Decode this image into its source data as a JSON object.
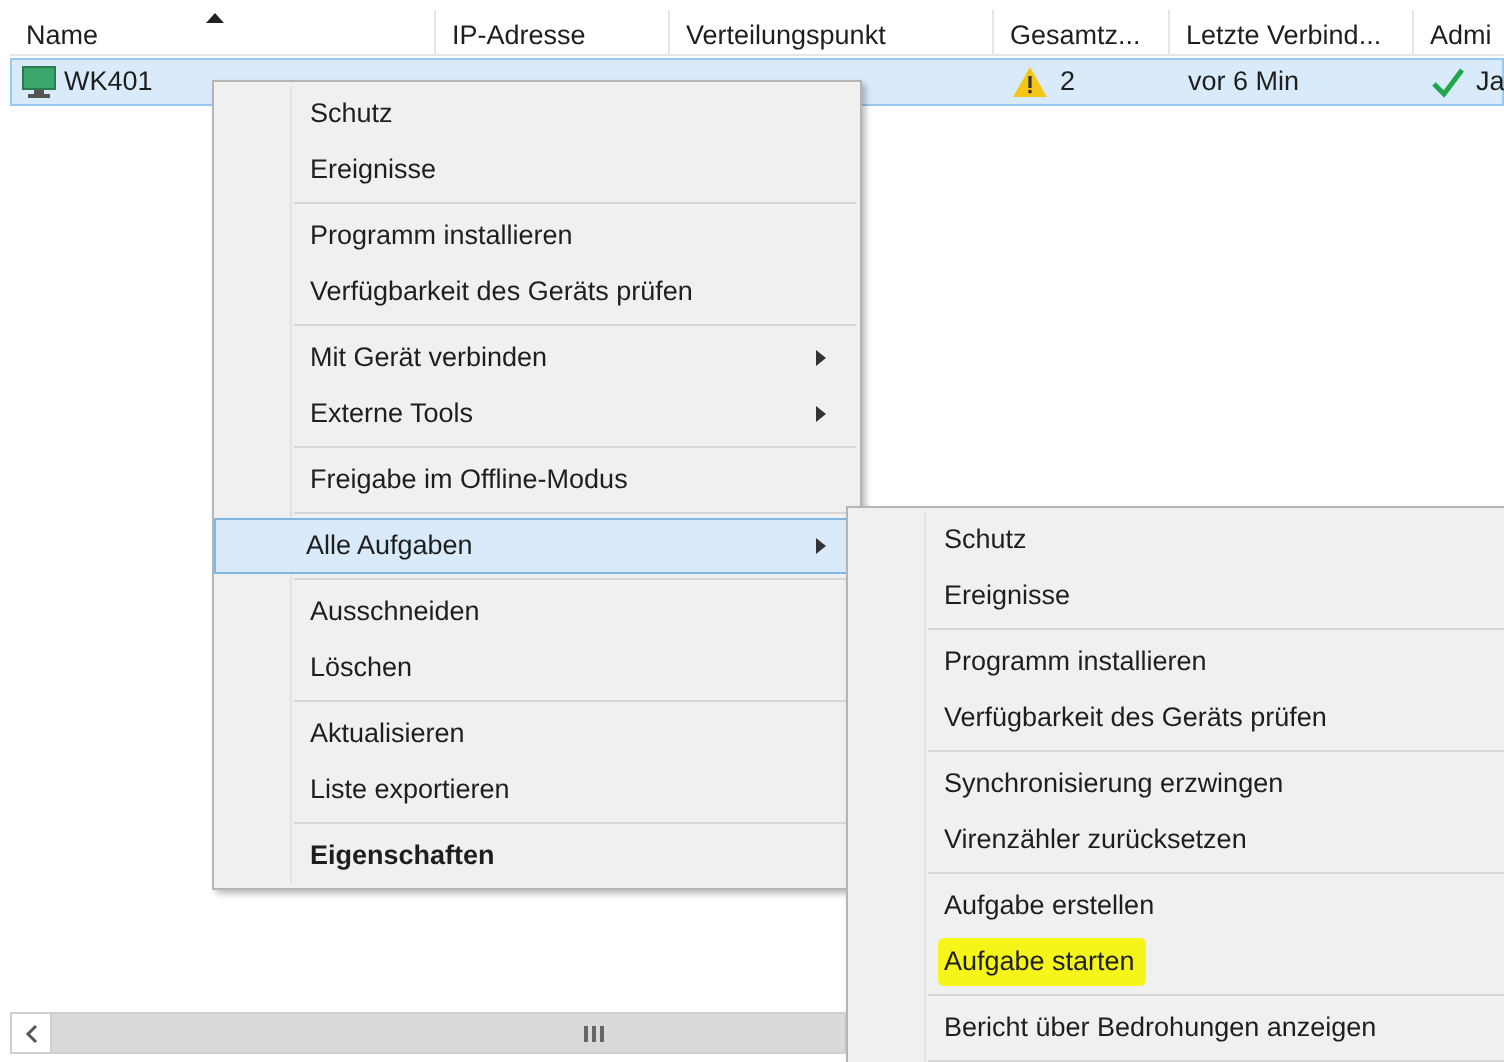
{
  "table": {
    "columns": [
      {
        "label": "Name",
        "sorted": true
      },
      {
        "label": "IP-Adresse",
        "sorted": false
      },
      {
        "label": "Verteilungspunkt",
        "sorted": false
      },
      {
        "label": "Gesamtz...",
        "sorted": false
      },
      {
        "label": "Letzte Verbind...",
        "sorted": false
      },
      {
        "label": "Admi",
        "sorted": false
      }
    ],
    "rows": [
      {
        "selected": true,
        "name": "WK401",
        "total": "2",
        "last_connection": "vor 6 Min",
        "admin": "Ja"
      }
    ]
  },
  "context_menu": {
    "items": [
      {
        "kind": "item",
        "label": "Schutz",
        "submenu": false,
        "bold": false,
        "selected": false
      },
      {
        "kind": "item",
        "label": "Ereignisse",
        "submenu": false,
        "bold": false,
        "selected": false
      },
      {
        "kind": "separator"
      },
      {
        "kind": "item",
        "label": "Programm installieren",
        "submenu": false,
        "bold": false,
        "selected": false
      },
      {
        "kind": "item",
        "label": "Verfügbarkeit des Geräts prüfen",
        "submenu": false,
        "bold": false,
        "selected": false
      },
      {
        "kind": "separator"
      },
      {
        "kind": "item",
        "label": "Mit Gerät verbinden",
        "submenu": true,
        "bold": false,
        "selected": false
      },
      {
        "kind": "item",
        "label": "Externe Tools",
        "submenu": true,
        "bold": false,
        "selected": false
      },
      {
        "kind": "separator"
      },
      {
        "kind": "item",
        "label": "Freigabe im Offline-Modus",
        "submenu": false,
        "bold": false,
        "selected": false
      },
      {
        "kind": "separator"
      },
      {
        "kind": "item",
        "label": "Alle Aufgaben",
        "submenu": true,
        "bold": false,
        "selected": true
      },
      {
        "kind": "separator"
      },
      {
        "kind": "item",
        "label": "Ausschneiden",
        "submenu": false,
        "bold": false,
        "selected": false
      },
      {
        "kind": "item",
        "label": "Löschen",
        "submenu": false,
        "bold": false,
        "selected": false
      },
      {
        "kind": "separator"
      },
      {
        "kind": "item",
        "label": "Aktualisieren",
        "submenu": false,
        "bold": false,
        "selected": false
      },
      {
        "kind": "item",
        "label": "Liste exportieren",
        "submenu": false,
        "bold": false,
        "selected": false
      },
      {
        "kind": "separator"
      },
      {
        "kind": "item",
        "label": "Eigenschaften",
        "submenu": false,
        "bold": true,
        "selected": false
      }
    ]
  },
  "submenu": {
    "items": [
      {
        "kind": "item",
        "label": "Schutz",
        "marked": false
      },
      {
        "kind": "item",
        "label": "Ereignisse",
        "marked": false
      },
      {
        "kind": "separator"
      },
      {
        "kind": "item",
        "label": "Programm installieren",
        "marked": false
      },
      {
        "kind": "item",
        "label": "Verfügbarkeit des Geräts prüfen",
        "marked": false
      },
      {
        "kind": "separator"
      },
      {
        "kind": "item",
        "label": "Synchronisierung erzwingen",
        "marked": false
      },
      {
        "kind": "item",
        "label": "Virenzähler zurücksetzen",
        "marked": false
      },
      {
        "kind": "separator"
      },
      {
        "kind": "item",
        "label": "Aufgabe erstellen",
        "marked": false
      },
      {
        "kind": "item",
        "label": "Aufgabe starten",
        "marked": true
      },
      {
        "kind": "separator"
      },
      {
        "kind": "item",
        "label": "Bericht über Bedrohungen anzeigen",
        "marked": false
      },
      {
        "kind": "separator"
      }
    ]
  }
}
